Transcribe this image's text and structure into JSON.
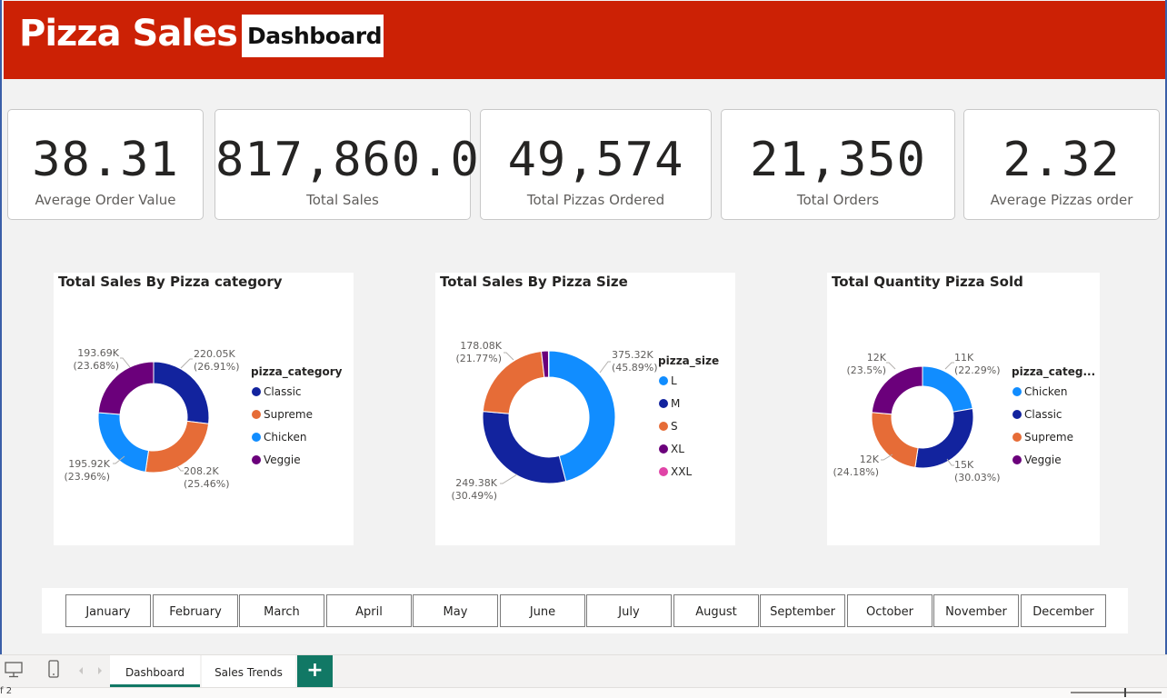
{
  "header": {
    "title": "Pizza Sales|",
    "badge": "Dashboard"
  },
  "kpis": [
    {
      "value": "38.31",
      "label": "Average Order Value"
    },
    {
      "value": "817,860.05",
      "label": "Total Sales"
    },
    {
      "value": "49,574",
      "label": "Total Pizzas Ordered"
    },
    {
      "value": "21,350",
      "label": "Total Orders"
    },
    {
      "value": "2.32",
      "label": "Average Pizzas order"
    }
  ],
  "chart_data": [
    {
      "type": "pie",
      "title": "Total Sales By Pizza category",
      "legend_title": "pizza_category",
      "legend_position": "right",
      "donut": true,
      "slices": [
        {
          "name": "Classic",
          "value": 220053,
          "label": "220.05K",
          "pct": "(26.91%)",
          "color": "#12239e"
        },
        {
          "name": "Supreme",
          "value": 208197,
          "label": "208.2K",
          "pct": "(25.46%)",
          "color": "#e66c37"
        },
        {
          "name": "Chicken",
          "value": 195920,
          "label": "195.92K",
          "pct": "(23.96%)",
          "color": "#118dff"
        },
        {
          "name": "Veggie",
          "value": 193690,
          "label": "193.69K",
          "pct": "(23.68%)",
          "color": "#6b007b"
        }
      ]
    },
    {
      "type": "pie",
      "title": "Total Sales By Pizza Size",
      "legend_title": "pizza_size",
      "legend_position": "right",
      "donut": true,
      "slices": [
        {
          "name": "L",
          "value": 375320,
          "label": "375.32K",
          "pct": "(45.89%)",
          "color": "#118dff"
        },
        {
          "name": "M",
          "value": 249380,
          "label": "249.38K",
          "pct": "(30.49%)",
          "color": "#12239e"
        },
        {
          "name": "S",
          "value": 178080,
          "label": "178.08K",
          "pct": "(21.77%)",
          "color": "#e66c37"
        },
        {
          "name": "XL",
          "value": 14080,
          "label": "",
          "pct": "",
          "color": "#6b007b"
        },
        {
          "name": "XXL",
          "value": 1000,
          "label": "",
          "pct": "",
          "color": "#e044a7"
        }
      ]
    },
    {
      "type": "pie",
      "title": "Total Quantity Pizza Sold",
      "legend_title": "pizza_categ...",
      "legend_position": "right",
      "donut": true,
      "slices": [
        {
          "name": "Chicken",
          "value": 11050,
          "label": "11K",
          "pct": "(22.29%)",
          "color": "#118dff"
        },
        {
          "name": "Classic",
          "value": 14888,
          "label": "15K",
          "pct": "(30.03%)",
          "color": "#12239e"
        },
        {
          "name": "Supreme",
          "value": 11987,
          "label": "12K",
          "pct": "(24.18%)",
          "color": "#e66c37"
        },
        {
          "name": "Veggie",
          "value": 11649,
          "label": "12K",
          "pct": "(23.5%)",
          "color": "#6b007b"
        }
      ]
    }
  ],
  "months": [
    "January",
    "February",
    "March",
    "April",
    "May",
    "June",
    "July",
    "August",
    "September",
    "October",
    "November",
    "December"
  ],
  "tabs": {
    "active": "Dashboard",
    "second": "Sales Trends",
    "add": "+"
  },
  "status": {
    "page": "f 2"
  }
}
